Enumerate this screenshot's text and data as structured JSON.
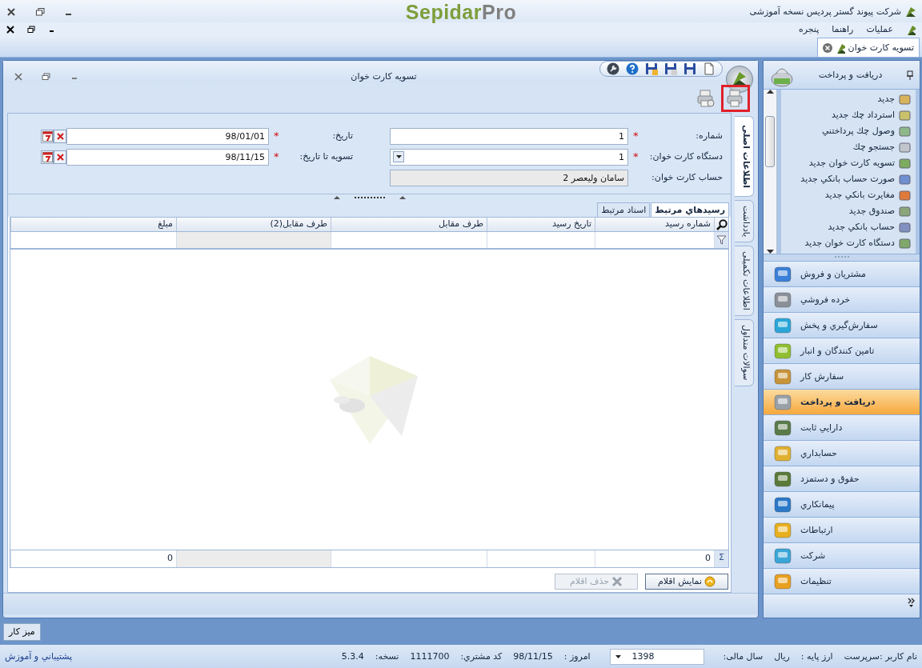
{
  "app": {
    "title": "شرکت پیوند گستر پردیس نسخه آموزشی",
    "logo_main": "Sepidar",
    "logo_suffix": "Pro"
  },
  "menu": [
    "عملیات",
    "راهنما",
    "پنجره"
  ],
  "doc_tabs": [
    {
      "label": "تسویه کارت خوان",
      "selected": true
    }
  ],
  "window": {
    "title": "تسویه کارت خوان",
    "tools": [
      {
        "kind": "print",
        "highlighted": true
      },
      {
        "kind": "preview",
        "highlighted": false
      }
    ]
  },
  "form": {
    "right": [
      {
        "label": "شماره:",
        "required_mark": "*",
        "kind": "text",
        "value": "1"
      },
      {
        "label": "دستگاه کارت خوان:",
        "required_mark": "*",
        "kind": "select",
        "value": "1"
      },
      {
        "label": "حساب کارت خوان:",
        "kind": "readonly",
        "value": "سامان ولیعصر 2"
      }
    ],
    "left": [
      {
        "label": "تاریخ:",
        "required_mark": "*",
        "kind": "date",
        "value": "98/01/01"
      },
      {
        "label": "تسویه تا تاریخ:",
        "required_mark": "*",
        "kind": "date",
        "value": "98/11/15"
      }
    ]
  },
  "detail_tabs": [
    {
      "label": "رسيدهاي مرتبط",
      "selected": true
    },
    {
      "label": "اسناد مرتبط",
      "selected": false
    }
  ],
  "side_tabs": [
    {
      "label": "اطلاعات اصلی",
      "selected": true
    },
    {
      "label": "یادداشت",
      "selected": false
    },
    {
      "label": "اطلاعات تکمیلی",
      "selected": false
    },
    {
      "label": "سوالات متداول",
      "selected": false
    }
  ],
  "grid": {
    "columns": [
      {
        "label": "شماره رسيد",
        "shaded": false,
        "total": "0"
      },
      {
        "label": "تاريخ رسيد",
        "shaded": false
      },
      {
        "label": "طرف مقابل",
        "shaded": false
      },
      {
        "label": "طرف مقابل(2)",
        "shaded": true
      },
      {
        "label": "مبلغ",
        "shaded": false,
        "total": "0"
      }
    ],
    "totals_symbol": "Σ"
  },
  "buttons": [
    {
      "label": "نمايش اقلام",
      "kind": "show",
      "disabled": false
    },
    {
      "label": "حذف اقلام",
      "kind": "delete",
      "disabled": true
    }
  ],
  "nav": {
    "title": "دریافت و پرداخت",
    "items": [
      "جديد",
      "استرداد چك جديد",
      "وصول چك پرداختني",
      "جستجو چك",
      "تسويه کارت خوان جديد",
      "صورت حساب بانکي جديد",
      "مغايرت بانکي جديد",
      "صندوق جديد",
      "حساب بانکي جديد",
      "دستگاه کارت خوان جديد"
    ],
    "modules": [
      {
        "label": "مشتريان و فروش",
        "selected": false
      },
      {
        "label": "خرده فروشي",
        "selected": false
      },
      {
        "label": "سفارش‌گيري و پخش",
        "selected": false
      },
      {
        "label": "تامين کنندگان و انبار",
        "selected": false
      },
      {
        "label": "سفارش کار",
        "selected": false
      },
      {
        "label": "دريافت و پرداخت",
        "selected": true
      },
      {
        "label": "دارايي ثابت",
        "selected": false
      },
      {
        "label": "حسابداري",
        "selected": false
      },
      {
        "label": "حقوق و دستمزد",
        "selected": false
      },
      {
        "label": "پيمانکاري",
        "selected": false
      },
      {
        "label": "ارتباطات",
        "selected": false
      },
      {
        "label": "شرکت",
        "selected": false
      },
      {
        "label": "تنظيمات",
        "selected": false
      }
    ]
  },
  "taskbar": {
    "label": "میز کار"
  },
  "status": {
    "user": "نام کاربر :سرپرست",
    "currency_label": "ارز پایه :",
    "currency": "ریال",
    "fiscal_year_label": "سال مالی:",
    "fiscal_year": "1398",
    "today_label": "امروز :",
    "today": "98/11/15",
    "customer_code_label": "کد مشتري:",
    "customer_code": "1111700",
    "version_label": "نسخه:",
    "version": "5.3.4",
    "support_link": "پشتيباني و آموزش"
  }
}
